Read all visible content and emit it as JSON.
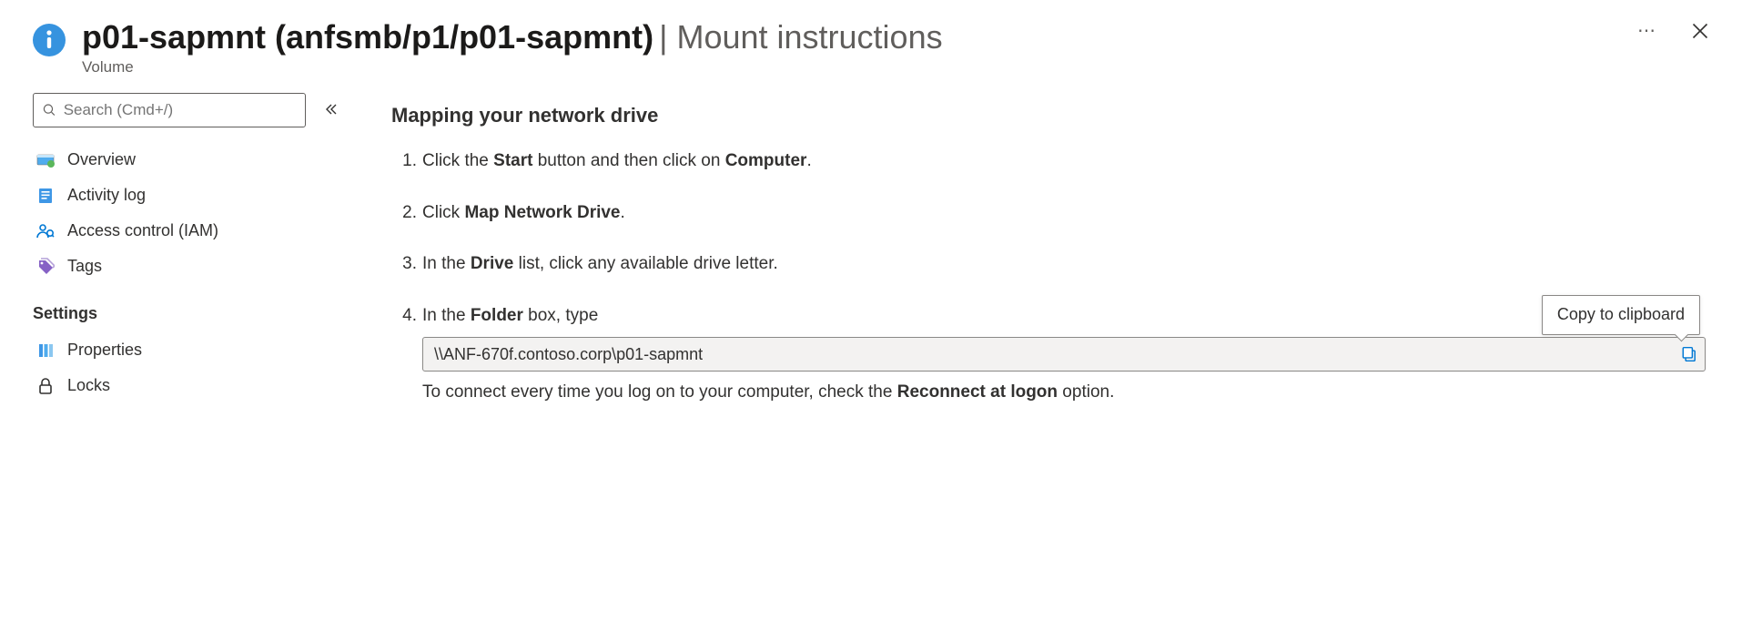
{
  "header": {
    "title_bold": "p01-sapmnt (anfsmb/p1/p01-sapmnt)",
    "title_subtitle": "Mount instructions",
    "resource_type": "Volume"
  },
  "sidebar": {
    "search_placeholder": "Search (Cmd+/)",
    "items": {
      "overview": "Overview",
      "activity_log": "Activity log",
      "access_control": "Access control (IAM)",
      "tags": "Tags"
    },
    "settings_group_label": "Settings",
    "settings_items": {
      "properties": "Properties",
      "locks": "Locks"
    }
  },
  "main": {
    "section_title": "Mapping your network drive",
    "step1": {
      "pre": "Click the ",
      "b1": "Start",
      "mid": " button and then click on ",
      "b2": "Computer",
      "post": "."
    },
    "step2": {
      "pre": "Click ",
      "b1": "Map Network Drive",
      "post": "."
    },
    "step3": {
      "pre": "In the ",
      "b1": "Drive",
      "post": " list, click any available drive letter."
    },
    "step4": {
      "pre": "In the ",
      "b1": "Folder",
      "post": " box, type",
      "path": "\\\\ANF-670f.contoso.corp\\p01-sapmnt",
      "helper_pre": "To connect every time you log on to your computer, check the ",
      "helper_b": "Reconnect at logon",
      "helper_post": " option."
    },
    "tooltip": "Copy to clipboard"
  }
}
